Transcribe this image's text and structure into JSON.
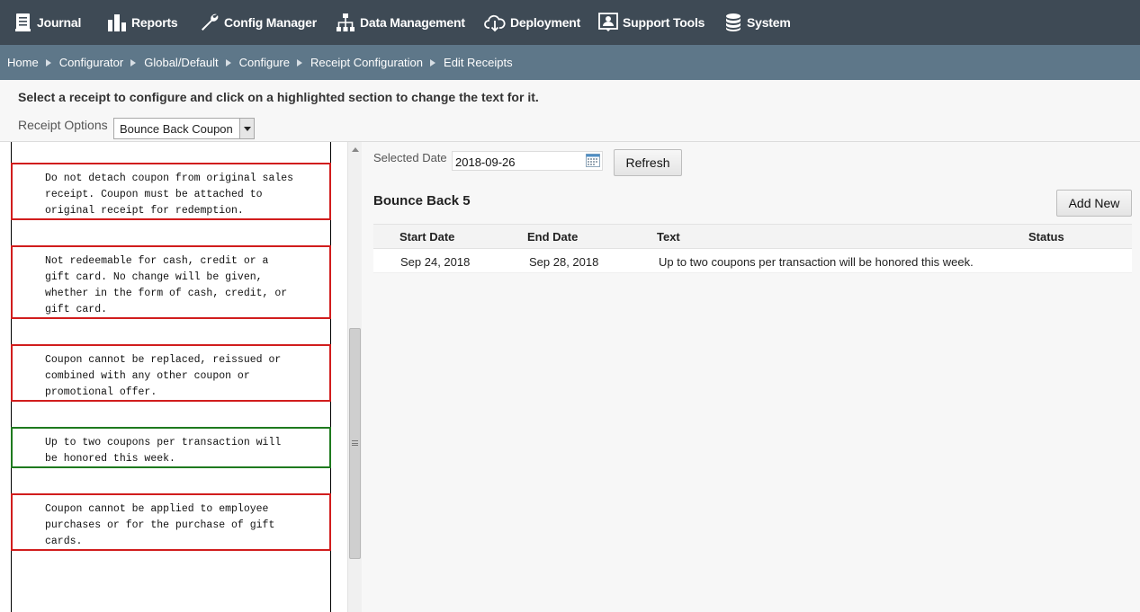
{
  "nav": {
    "items": [
      {
        "label": "Journal",
        "icon": "journal-icon"
      },
      {
        "label": "Reports",
        "icon": "bar-chart-icon"
      },
      {
        "label": "Config Manager",
        "icon": "wrench-icon"
      },
      {
        "label": "Data Management",
        "icon": "hierarchy-icon"
      },
      {
        "label": "Deployment",
        "icon": "cloud-download-icon"
      },
      {
        "label": "Support Tools",
        "icon": "support-person-icon"
      },
      {
        "label": "System",
        "icon": "database-icon"
      }
    ]
  },
  "breadcrumb": [
    "Home",
    "Configurator",
    "Global/Default",
    "Configure",
    "Receipt Configuration",
    "Edit Receipts"
  ],
  "instructions": "Select a receipt to configure and click on a highlighted section to change the text for it.",
  "receipt_options": {
    "label": "Receipt Options",
    "selected": "Bounce Back Coupon"
  },
  "receipt_sections": [
    {
      "text": "Do not detach coupon from original sales\nreceipt. Coupon must be attached to\noriginal receipt for redemption.",
      "state": "highlighted"
    },
    {
      "text": "Not redeemable for cash, credit or a\ngift card. No change will be given,\nwhether in the form of cash, credit, or\ngift card.",
      "state": "highlighted"
    },
    {
      "text": "Coupon cannot be replaced, reissued or\ncombined with any other coupon or\npromotional offer.",
      "state": "highlighted"
    },
    {
      "text": "Up to two coupons per transaction will\nbe honored this week.",
      "state": "selected"
    },
    {
      "text": "Coupon cannot be applied to employee\npurchases or for the purchase of gift\ncards.",
      "state": "highlighted"
    }
  ],
  "date_filter": {
    "label": "Selected Date",
    "value": "2018-09-26",
    "refresh_label": "Refresh"
  },
  "section_title": "Bounce Back 5",
  "add_new_label": "Add New",
  "table": {
    "columns": [
      "Start Date",
      "End Date",
      "Text",
      "Status"
    ],
    "rows": [
      {
        "start": "Sep 24, 2018",
        "end": "Sep 28, 2018",
        "text": "Up to two coupons per transaction will be honored this week.",
        "status": ""
      }
    ]
  },
  "colors": {
    "nav_bg": "#3e4a55",
    "breadcrumb_bg": "#5e7789",
    "section_border": "#d11d1d",
    "selected_border": "#1e7a1e"
  }
}
